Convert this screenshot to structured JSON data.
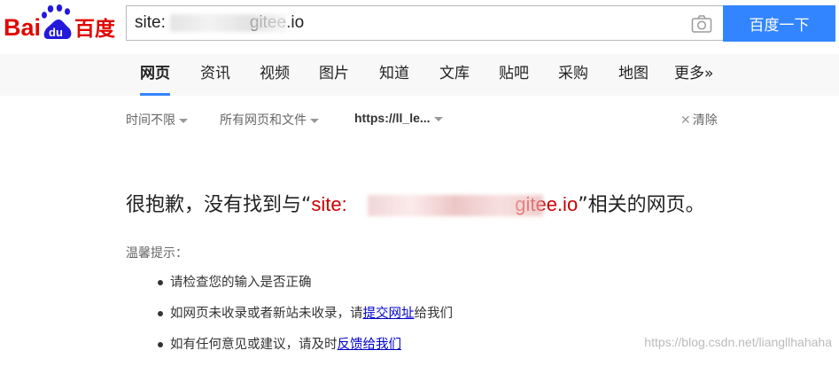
{
  "logo": {
    "left_text": "Bai",
    "paw_text": "du",
    "right_text": "百度"
  },
  "search": {
    "value": "site:                  gitee.io",
    "button_label": "百度一下"
  },
  "tabs": [
    "网页",
    "资讯",
    "视频",
    "图片",
    "知道",
    "文库",
    "贴吧",
    "采购",
    "地图",
    "更多»"
  ],
  "filters": {
    "time": "时间不限",
    "type": "所有网页和文件",
    "site": "https://ll_le...",
    "clear": "清除"
  },
  "message": {
    "prefix": "很抱歉，没有找到与“",
    "query": "site:                               gitee.io",
    "suffix": "”相关的网页。"
  },
  "tips": {
    "title": "温馨提示：",
    "items": [
      {
        "text": "请检查您的输入是否正确",
        "link": "",
        "after": ""
      },
      {
        "text": "如网页未收录或者新站未收录，请",
        "link": "提交网址",
        "after": "给我们"
      },
      {
        "text": "如有任何意见或建议，请及时",
        "link": "反馈给我们",
        "after": ""
      }
    ]
  },
  "watermark": "https://blog.csdn.net/liangllhahaha",
  "colors": {
    "accent": "#3385ff",
    "logo_red": "#e10602",
    "logo_blue": "#2319dc",
    "error_red": "#cc0000",
    "link_blue": "#0000cc"
  }
}
